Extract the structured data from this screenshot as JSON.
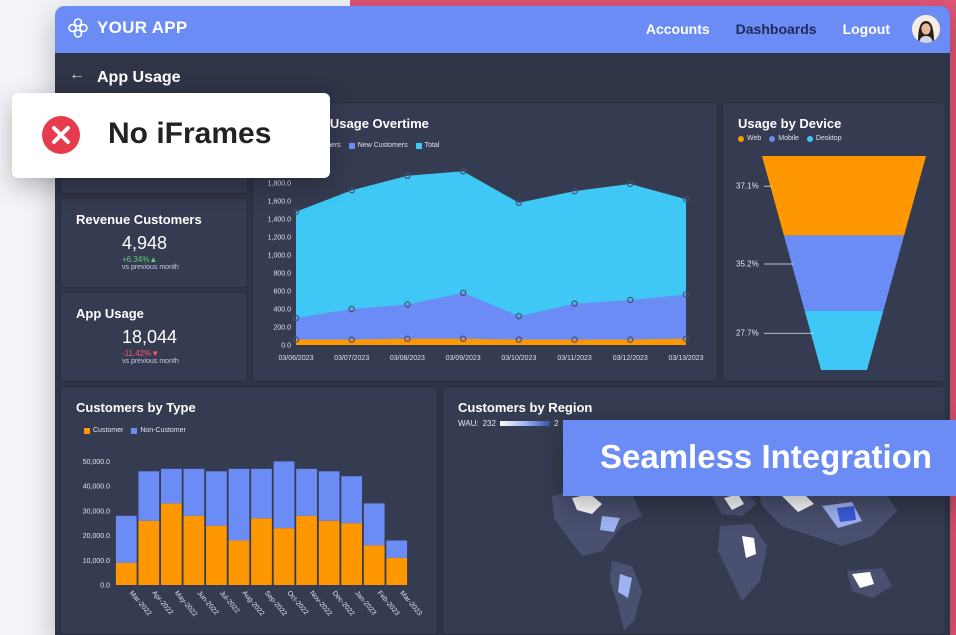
{
  "header": {
    "brand": "YOUR APP",
    "nav": [
      "Accounts",
      "Dashboards",
      "Logout"
    ]
  },
  "page": {
    "title": "App Usage"
  },
  "kpis": [
    {
      "title": "Revenue Customers",
      "value": "4,948",
      "delta": "+6.34%▲",
      "sub": "vs previous month"
    },
    {
      "title": "App Usage",
      "value": "18,044",
      "delta": "-11.42%▼",
      "sub": "vs previous month"
    }
  ],
  "overlays": {
    "no_iframes": "No iFrames",
    "seamless": "Seamless Integration"
  },
  "colors": {
    "orange": "#ff9800",
    "blue": "#6b8cf5",
    "cyan": "#3fc8f5",
    "green": "#5dd17a",
    "red": "#ff5a6a"
  },
  "charts": {
    "usage_title": "rs Usage Overtime",
    "usage_legend": [
      "ustomers",
      "New Customers",
      "Total"
    ],
    "device_title": "Usage by Device",
    "device_legend": [
      "Web",
      "Mobile",
      "Desktop"
    ],
    "type_title": "Customers by Type",
    "type_legend": [
      "Customer",
      "Non-Customer"
    ],
    "region_title": "Customers by Region",
    "region_wau": "WAU:",
    "region_wau_value": "232",
    "region_wau_value2": "2"
  },
  "chart_data": [
    {
      "type": "area",
      "title": "rs Usage Overtime",
      "x": [
        "03/06/2023",
        "03/07/2023",
        "03/08/2023",
        "03/09/2023",
        "03/10/2023",
        "03/11/2023",
        "03/12/2023",
        "03/13/2023"
      ],
      "yticks": [
        "0.0",
        "200.0",
        "400.0",
        "600.0",
        "800.0",
        "1,000.0",
        "1,200.0",
        "1,400.0",
        "1,600.0",
        "1,800.0"
      ],
      "ylim": [
        0,
        1900
      ],
      "series": [
        {
          "name": "ustomers",
          "values": [
            60,
            60,
            70,
            70,
            60,
            60,
            60,
            70
          ]
        },
        {
          "name": "New Customers",
          "values": [
            300,
            400,
            450,
            580,
            320,
            460,
            500,
            560
          ]
        },
        {
          "name": "Total",
          "values": [
            1480,
            1720,
            1880,
            1930,
            1580,
            1710,
            1790,
            1620
          ]
        }
      ]
    },
    {
      "type": "funnel",
      "title": "Usage by Device",
      "labels": [
        "37.1%",
        "35.2%",
        "27.7%"
      ],
      "categories": [
        "Web",
        "Mobile",
        "Desktop"
      ],
      "values": [
        37.1,
        35.2,
        27.7
      ]
    },
    {
      "type": "bar",
      "title": "Customers by Type",
      "categories": [
        "Mar-2022",
        "Apr-2022",
        "May-2022",
        "Jun-2022",
        "Jul-2022",
        "Aug-2022",
        "Sep-2022",
        "Oct-2022",
        "Nov-2022",
        "Dec-2022",
        "Jan-2023",
        "Feb-2023",
        "Mar-2023"
      ],
      "yticks": [
        "0.0",
        "10,000.0",
        "20,000.0",
        "30,000.0",
        "40,000.0",
        "50,000.0"
      ],
      "ylim": [
        0,
        53000
      ],
      "series": [
        {
          "name": "Customer",
          "values": [
            9000,
            26000,
            33000,
            28000,
            24000,
            18000,
            27000,
            23000,
            28000,
            26000,
            25000,
            16000,
            11000
          ]
        },
        {
          "name": "Non-Customer",
          "values": [
            19000,
            20000,
            14000,
            19000,
            22000,
            29000,
            20000,
            27000,
            19000,
            20000,
            19000,
            17000,
            7000
          ]
        }
      ]
    }
  ]
}
